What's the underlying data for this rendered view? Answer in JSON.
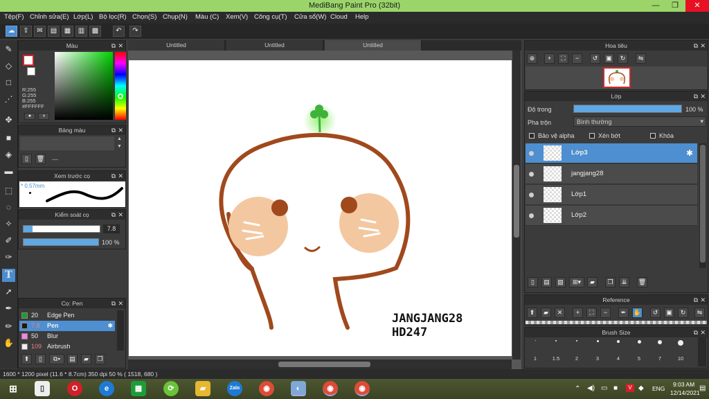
{
  "window": {
    "title": "MediBang Paint Pro (32bit)",
    "minimize": "—",
    "maximize": "❐",
    "close": "✕"
  },
  "menu": [
    "Tệp(F)",
    "Chỉnh sửa(E)",
    "Lớp(L)",
    "Bộ lọc(R)",
    "Chọn(S)",
    "Chụp(N)",
    "Màu (C)",
    "Xem(V)",
    "Công cụ(T)",
    "Cửa sổ(W)",
    "Cloud",
    "Help"
  ],
  "tabs": [
    "Untitled",
    "Untitled",
    "Untitled"
  ],
  "color_panel": {
    "title": "Màu",
    "r": "R:255",
    "g": "G:255",
    "b": "B:255",
    "hex": "#FFFFFF"
  },
  "palette_panel": {
    "title": "Bảng màu",
    "dash": "---"
  },
  "brush_preview": {
    "title": "Xem trước cọ",
    "size": "0.57mm"
  },
  "brush_control": {
    "title": "Kiểm soát cọ",
    "size_value": "7.8",
    "opacity_value": "100 %",
    "size_fraction": 0.12,
    "opacity_fraction": 1.0
  },
  "brush_list": {
    "title": "Cọ: Pen",
    "items": [
      {
        "size": "20",
        "name": "Edge Pen",
        "color": "#1e9c2a"
      },
      {
        "size": "7.8",
        "name": "Pen",
        "color": "#1a1a1a"
      },
      {
        "size": "50",
        "name": "Blur",
        "color": "#ff7fe6"
      },
      {
        "size": "109",
        "name": "Airbrush",
        "color": "#eeeeee"
      }
    ]
  },
  "navigator": {
    "title": "Hoa tiêu"
  },
  "layers": {
    "title": "Lớp",
    "opacity_label": "Độ trong",
    "opacity_value": "100 %",
    "opacity_fraction": 1.0,
    "blend_label": "Pha trộn",
    "blend_value": "Bình thường",
    "protect_alpha": "Bảo vệ alpha",
    "clipping": "Xén bớt",
    "lock": "Khóa",
    "items": [
      {
        "name": "Lớp3"
      },
      {
        "name": "jangjang28"
      },
      {
        "name": "Lớp1"
      },
      {
        "name": "Lớp2"
      }
    ]
  },
  "reference": {
    "title": "Reference"
  },
  "brush_size": {
    "title": "Brush Size",
    "sizes": [
      "1",
      "1.5",
      "2",
      "3",
      "4",
      "5",
      "7",
      "10"
    ]
  },
  "artwork": {
    "text_line1": "JANGJANG28",
    "text_line2": "HD247"
  },
  "status": {
    "text": "1600 * 1200 pixel   (11.6 * 8.7cm)   350 dpi   50 %   ( 1518, 680 )"
  },
  "taskbar": {
    "lang": "ENG",
    "time": "9:03 AM",
    "date": "12/14/2021",
    "zalo": "Zalo"
  },
  "colors": {
    "accent": "#4d8fd0",
    "titlebar": "#9bd56a",
    "outline": "#a0491d",
    "cheek": "#f3c8a0"
  }
}
